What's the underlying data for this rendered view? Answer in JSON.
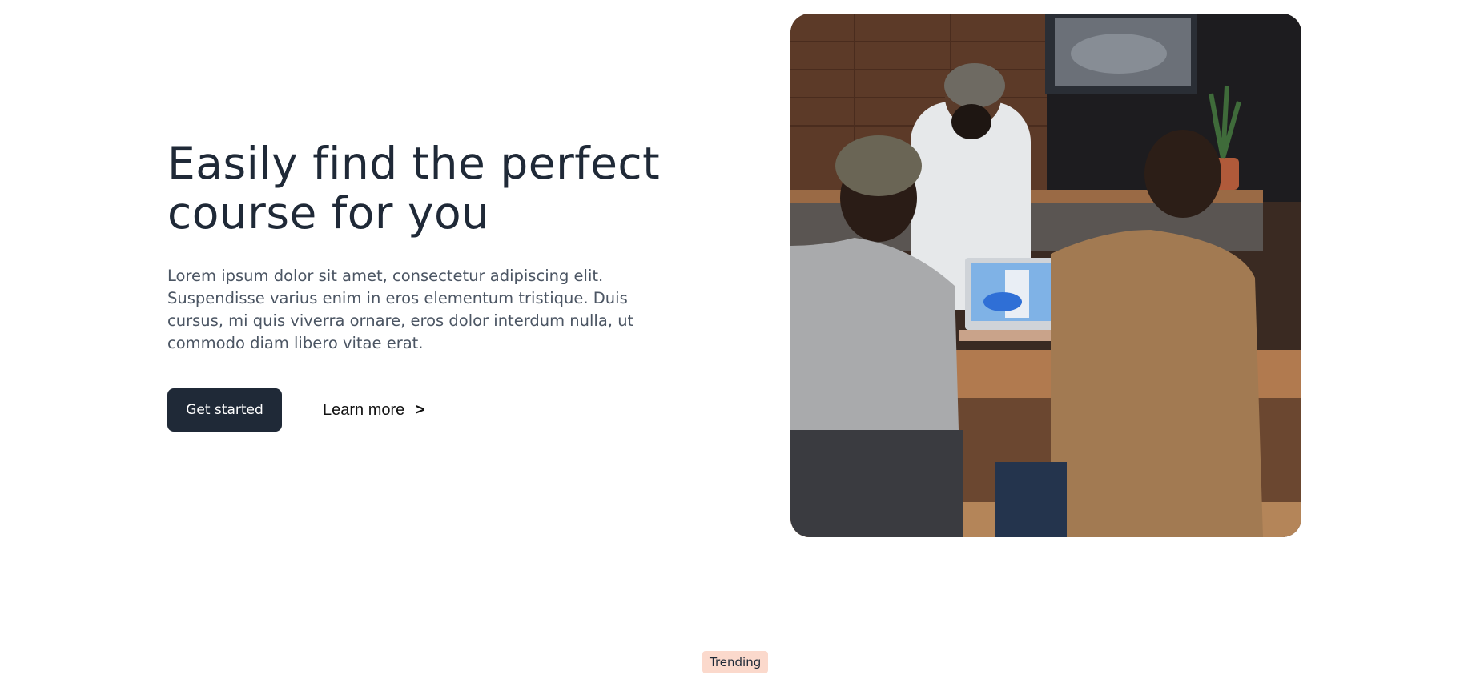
{
  "hero": {
    "title_line1": "Easily find the perfect",
    "title_line2": "course for you",
    "description": "Lorem ipsum dolor sit amet, consectetur adipiscing elit. Suspendisse varius enim in eros elementum tristique. Duis cursus, mi quis viverra ornare, eros dolor interdum nulla, ut commodo diam libero vitae erat.",
    "primary_button_label": "Get started",
    "secondary_button_label": "Learn more",
    "secondary_button_icon": "chevron-right-icon",
    "secondary_button_glyph": ">"
  },
  "image": {
    "alt": "Three people in beanies gathered around a laptop at a wooden table in a cafe"
  },
  "section": {
    "badge_label": "Trending"
  },
  "colors": {
    "primary": "#1f2937",
    "badge_bg": "#fbd9cc",
    "text_muted": "#4b5563"
  }
}
